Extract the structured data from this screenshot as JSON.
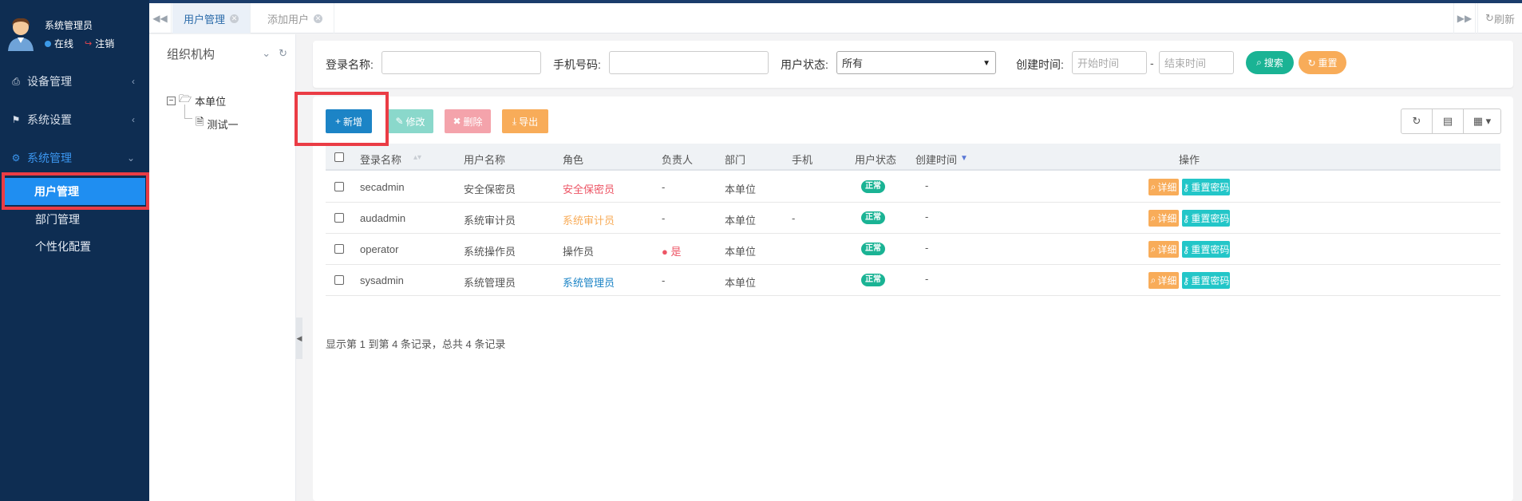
{
  "user": {
    "name": "系统管理员",
    "online": "在线",
    "logout": "注销"
  },
  "sidebar": {
    "menus": [
      {
        "icon": "printer-icon",
        "label": "设备管理"
      },
      {
        "icon": "flag-icon",
        "label": "系统设置"
      },
      {
        "icon": "gear-icon",
        "label": "系统管理"
      }
    ],
    "submenus": [
      {
        "label": "用户管理",
        "selected": true
      },
      {
        "label": "部门管理"
      },
      {
        "label": "个性化配置"
      }
    ]
  },
  "tabs": {
    "items": [
      {
        "label": "用户管理",
        "active": true
      },
      {
        "label": "添加用户"
      }
    ],
    "refresh": "刷新"
  },
  "org": {
    "title": "组织机构",
    "tree": {
      "root": "本单位",
      "child": "测试一"
    }
  },
  "search": {
    "login_name_label": "登录名称:",
    "phone_label": "手机号码:",
    "status_label": "用户状态:",
    "status_value": "所有",
    "created_label": "创建时间:",
    "start_placeholder": "开始时间",
    "end_placeholder": "结束时间",
    "range_dash": "-",
    "search_btn": "搜索",
    "reset_btn": "重置"
  },
  "toolbar": {
    "add": "新增",
    "edit": "修改",
    "delete": "删除",
    "export": "导出"
  },
  "table": {
    "headers": [
      "登录名称",
      "用户名称",
      "角色",
      "负责人",
      "部门",
      "手机",
      "用户状态",
      "创建时间",
      "操作"
    ],
    "rows": [
      {
        "login": "secadmin",
        "name": "安全保密员",
        "role": "安全保密员",
        "role_color": "#ed5565",
        "owner": "-",
        "dept": "本单位",
        "phone": "",
        "status": "正常",
        "created": "-"
      },
      {
        "login": "audadmin",
        "name": "系统审计员",
        "role": "系统审计员",
        "role_color": "#f8ac59",
        "owner": "-",
        "dept": "本单位",
        "phone": "-",
        "status": "正常",
        "created": "-"
      },
      {
        "login": "operator",
        "name": "系统操作员",
        "role": "操作员",
        "role_color": "#555555",
        "owner": "是",
        "dept": "本单位",
        "phone": "",
        "status": "正常",
        "created": "-"
      },
      {
        "login": "sysadmin",
        "name": "系统管理员",
        "role": "系统管理员",
        "role_color": "#1c84c6",
        "owner": "-",
        "dept": "本单位",
        "phone": "",
        "status": "正常",
        "created": "-"
      }
    ],
    "action_detail": "详细",
    "action_reset_pwd": "重置密码"
  },
  "pagination": {
    "summary": "显示第 1 到第 4 条记录，总共 4 条记录"
  },
  "colors": {
    "primary": "#1c84c6",
    "teal": "#1ab394",
    "orange": "#f8ac59",
    "danger": "#ed5565",
    "cyan": "#23c6c8",
    "sidebar": "#0e2d52",
    "highlight": "#ea3c45"
  }
}
